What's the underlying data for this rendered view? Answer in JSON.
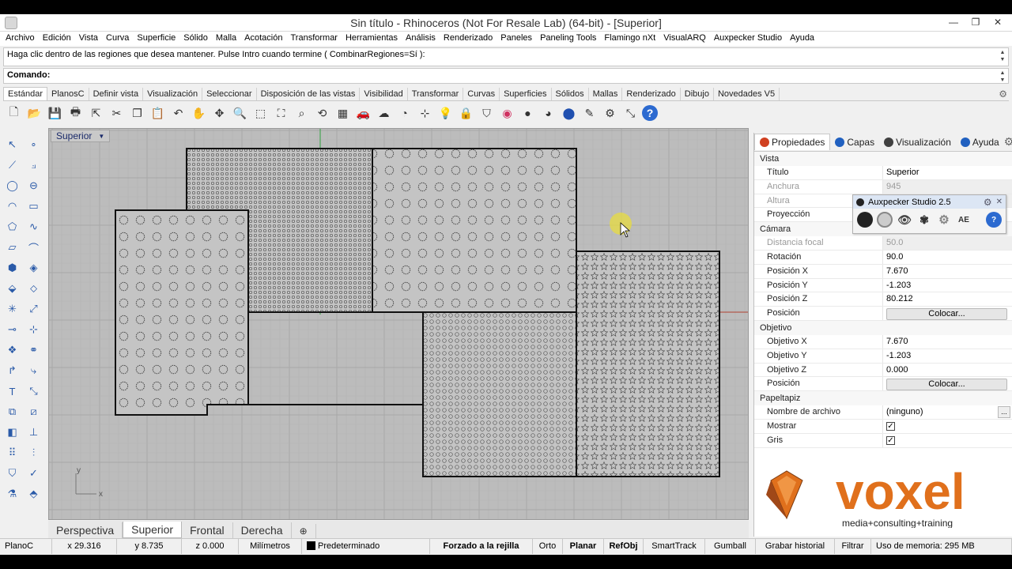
{
  "window": {
    "title": "Sin título - Rhinoceros (Not For Resale Lab) (64-bit) - [Superior]",
    "minimize": "—",
    "maximize": "❐",
    "close": "✕"
  },
  "menu": [
    "Archivo",
    "Edición",
    "Vista",
    "Curva",
    "Superficie",
    "Sólido",
    "Malla",
    "Acotación",
    "Transformar",
    "Herramientas",
    "Análisis",
    "Renderizado",
    "Paneles",
    "Paneling Tools",
    "Flamingo nXt",
    "VisualARQ",
    "Auxpecker Studio",
    "Ayuda"
  ],
  "command": {
    "history": "Haga clic dentro de las regiones que desea mantener. Pulse Intro cuando termine ( CombinarRegiones=Sí ):",
    "prompt": "Comando:"
  },
  "toolbar_tabs": [
    "Estándar",
    "PlanosC",
    "Definir vista",
    "Visualización",
    "Seleccionar",
    "Disposición de las vistas",
    "Visibilidad",
    "Transformar",
    "Curvas",
    "Superficies",
    "Sólidos",
    "Mallas",
    "Renderizado",
    "Dibujo",
    "Novedades V5"
  ],
  "main_toolbar_icons": [
    {
      "name": "new-document-icon",
      "glyph": "🗋"
    },
    {
      "name": "open-folder-icon",
      "glyph": "📂"
    },
    {
      "name": "save-icon",
      "glyph": "💾"
    },
    {
      "name": "print-icon",
      "glyph": "🖶"
    },
    {
      "name": "export-icon",
      "glyph": "⇱"
    },
    {
      "name": "cut-icon",
      "glyph": "✂"
    },
    {
      "name": "copy-icon",
      "glyph": "❐"
    },
    {
      "name": "paste-icon",
      "glyph": "📋"
    },
    {
      "name": "undo-icon",
      "glyph": "↶"
    },
    {
      "name": "pan-hand-icon",
      "glyph": "✋"
    },
    {
      "name": "rotate-view-icon",
      "glyph": "✥"
    },
    {
      "name": "zoom-icon",
      "glyph": "🔍"
    },
    {
      "name": "zoom-window-icon",
      "glyph": "⬚"
    },
    {
      "name": "zoom-extents-icon",
      "glyph": "⛶"
    },
    {
      "name": "zoom-selected-icon",
      "glyph": "⌕"
    },
    {
      "name": "rotate-icon",
      "glyph": "⟲"
    },
    {
      "name": "four-views-icon",
      "glyph": "▦"
    },
    {
      "name": "car-icon",
      "glyph": "🚗"
    },
    {
      "name": "sun-icon",
      "glyph": "☁"
    },
    {
      "name": "orbit-icon",
      "glyph": "◔"
    },
    {
      "name": "grid-snap-icon",
      "glyph": "⊹"
    },
    {
      "name": "lightbulb-icon",
      "glyph": "💡"
    },
    {
      "name": "lock-icon",
      "glyph": "🔒"
    },
    {
      "name": "shield-icon",
      "glyph": "⛉"
    },
    {
      "name": "color-wheel-icon",
      "glyph": "◉"
    },
    {
      "name": "shaded-sphere-icon",
      "glyph": "●"
    },
    {
      "name": "render-sphere-icon",
      "glyph": "◕"
    },
    {
      "name": "blue-sphere-icon",
      "glyph": "⬤"
    },
    {
      "name": "pen-icon",
      "glyph": "✎"
    },
    {
      "name": "settings-gear-icon",
      "glyph": "⚙"
    },
    {
      "name": "transform-icon",
      "glyph": "⤡"
    },
    {
      "name": "help-icon",
      "glyph": "?"
    }
  ],
  "left_toolbar_icons": [
    {
      "name": "select-arrow-icon",
      "glyph": "↖"
    },
    {
      "name": "point-icon",
      "glyph": "∘"
    },
    {
      "name": "line-icon",
      "glyph": "⟋"
    },
    {
      "name": "polyline-icon",
      "glyph": "⟓"
    },
    {
      "name": "circle-icon",
      "glyph": "◯"
    },
    {
      "name": "ellipse-icon",
      "glyph": "⊖"
    },
    {
      "name": "arc-icon",
      "glyph": "◠"
    },
    {
      "name": "rectangle-icon",
      "glyph": "▭"
    },
    {
      "name": "polygon-icon",
      "glyph": "⬠"
    },
    {
      "name": "curve-icon",
      "glyph": "∿"
    },
    {
      "name": "surface-icon",
      "glyph": "▱"
    },
    {
      "name": "loft-icon",
      "glyph": "⌒"
    },
    {
      "name": "box-icon",
      "glyph": "⬢"
    },
    {
      "name": "solid-union-icon",
      "glyph": "◈"
    },
    {
      "name": "extrude-icon",
      "glyph": "⬙"
    },
    {
      "name": "mesh-icon",
      "glyph": "⬦"
    },
    {
      "name": "split-icon",
      "glyph": "✳"
    },
    {
      "name": "trim-icon",
      "glyph": "⤢"
    },
    {
      "name": "join-icon",
      "glyph": "⊸"
    },
    {
      "name": "explode-icon",
      "glyph": "⊹"
    },
    {
      "name": "group-icon",
      "glyph": "❖"
    },
    {
      "name": "boolean-icon",
      "glyph": "⚭"
    },
    {
      "name": "fillet-icon",
      "glyph": "↱"
    },
    {
      "name": "chamfer-icon",
      "glyph": "⤷"
    },
    {
      "name": "text-icon",
      "glyph": "T"
    },
    {
      "name": "scale-icon",
      "glyph": "⤡"
    },
    {
      "name": "array-icon",
      "glyph": "⧉"
    },
    {
      "name": "mirror-icon",
      "glyph": "⧄"
    },
    {
      "name": "cube-icon",
      "glyph": "◧"
    },
    {
      "name": "dimension-icon",
      "glyph": "⊥"
    },
    {
      "name": "grid-array-icon",
      "glyph": "⠿"
    },
    {
      "name": "align-icon",
      "glyph": "⫶"
    },
    {
      "name": "shield-tool-icon",
      "glyph": "⛉"
    },
    {
      "name": "checkmark-icon",
      "glyph": "✓"
    },
    {
      "name": "paint-icon",
      "glyph": "⚗"
    },
    {
      "name": "hatch-icon",
      "glyph": "⬘"
    }
  ],
  "viewport": {
    "label": "Superior",
    "dropdown": "▼",
    "axis_x": "x",
    "axis_y": "y"
  },
  "viewport_tabs": [
    "Perspectiva",
    "Superior",
    "Frontal",
    "Derecha",
    "⊕"
  ],
  "panel_tabs": [
    {
      "label": "Propiedades",
      "color": "#d04020"
    },
    {
      "label": "Capas",
      "color": "#2060c0"
    },
    {
      "label": "Visualización",
      "color": "#404040"
    },
    {
      "label": "Ayuda",
      "color": "#2060c0"
    }
  ],
  "properties": {
    "vista": {
      "heading": "Vista",
      "titulo_label": "Título",
      "titulo_value": "Superior",
      "anchura_label": "Anchura",
      "anchura_value": "945",
      "altura_label": "Altura",
      "altura_value": "",
      "proyeccion_label": "Proyección",
      "proyeccion_value": ""
    },
    "camara": {
      "heading": "Cámara",
      "distancia_label": "Distancia focal",
      "distancia_value": "50.0",
      "rotacion_label": "Rotación",
      "rotacion_value": "90.0",
      "posx_label": "Posición X",
      "posx_value": "7.670",
      "posy_label": "Posición Y",
      "posy_value": "-1.203",
      "posz_label": "Posición Z",
      "posz_value": "80.212",
      "pos_label": "Posición",
      "pos_button": "Colocar..."
    },
    "objetivo": {
      "heading": "Objetivo",
      "objx_label": "Objetivo X",
      "objx_value": "7.670",
      "objy_label": "Objetivo Y",
      "objy_value": "-1.203",
      "objz_label": "Objetivo Z",
      "objz_value": "0.000",
      "pos_label": "Posición",
      "pos_button": "Colocar..."
    },
    "papeltapiz": {
      "heading": "Papeltapiz",
      "archivo_label": "Nombre de archivo",
      "archivo_value": "(ninguno)",
      "archivo_button": "...",
      "mostrar_label": "Mostrar",
      "mostrar_check": "✓",
      "gris_label": "Gris",
      "gris_check": "✓"
    }
  },
  "auxpecker": {
    "title": "Auxpecker Studio 2.5",
    "settings": "⚙",
    "close": "✕",
    "ae_label": "AE",
    "help": "?"
  },
  "logo": {
    "word": "voxel",
    "tagline": "media+consulting+training"
  },
  "status": {
    "cplane": "PlanoC",
    "x": "x 29.316",
    "y": "y 8.735",
    "z": "z 0.000",
    "units": "Milímetros",
    "layer": "Predeterminado",
    "grid_snap": "Forzado a la rejilla",
    "ortho": "Orto",
    "planar": "Planar",
    "osnap": "RefObj",
    "smarttrack": "SmartTrack",
    "gumball": "Gumball",
    "record_history": "Grabar historial",
    "filter": "Filtrar",
    "memory": "Uso de memoria: 295 MB"
  },
  "colors": {
    "viewport_bg": "#bcbcbc",
    "grid_major": "#a8a8a8",
    "grid_minor": "#b3b3b3",
    "x_axis": "#b04030",
    "y_axis": "#30a040",
    "cursor_highlight": "#e8dc40",
    "logo_orange": "#e0701c"
  }
}
